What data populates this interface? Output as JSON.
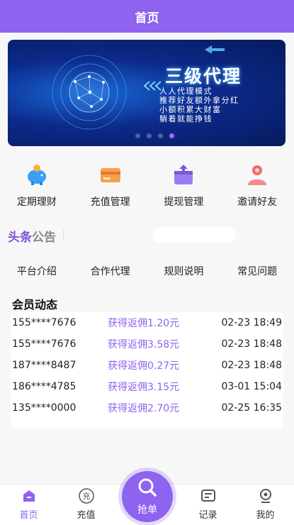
{
  "header": {
    "title": "首页"
  },
  "banner": {
    "headline": "三级代理",
    "lines": [
      "人人代理模式",
      "推荐好友额外拿分红",
      "小额积累大财富",
      "躺着就能挣钱"
    ],
    "slides": 4,
    "active_slide": 4
  },
  "quick_menu": [
    {
      "label": "定期理财",
      "icon": "piggy-bank-icon"
    },
    {
      "label": "充值管理",
      "icon": "card-icon"
    },
    {
      "label": "提现管理",
      "icon": "withdraw-box-icon"
    },
    {
      "label": "邀请好友",
      "icon": "invite-users-icon"
    }
  ],
  "headlines": {
    "logo_a": "头条",
    "logo_b": "公告"
  },
  "links": [
    "平台介绍",
    "合作代理",
    "规则说明",
    "常见问题"
  ],
  "activity": {
    "title": "会员动态",
    "rows": [
      {
        "user": "155****7676",
        "action": "获得返佣1.20元",
        "time": "02-23 18:49"
      },
      {
        "user": "155****7676",
        "action": "获得返佣3.58元",
        "time": "02-23 18:48"
      },
      {
        "user": "187****8487",
        "action": "获得返佣0.27元",
        "time": "02-23 18:48"
      },
      {
        "user": "186****4785",
        "action": "获得返佣3.15元",
        "time": "03-01 15:04"
      },
      {
        "user": "135****0000",
        "action": "获得返佣2.70元",
        "time": "02-25 16:35"
      }
    ]
  },
  "tabbar": {
    "home": "首页",
    "recharge": "充值",
    "grab": "抢单",
    "records": "记录",
    "mine": "我的",
    "recharge_icon_char": "充"
  },
  "colors": {
    "primary": "#8d63f0",
    "banner_dark": "#071a5e"
  }
}
